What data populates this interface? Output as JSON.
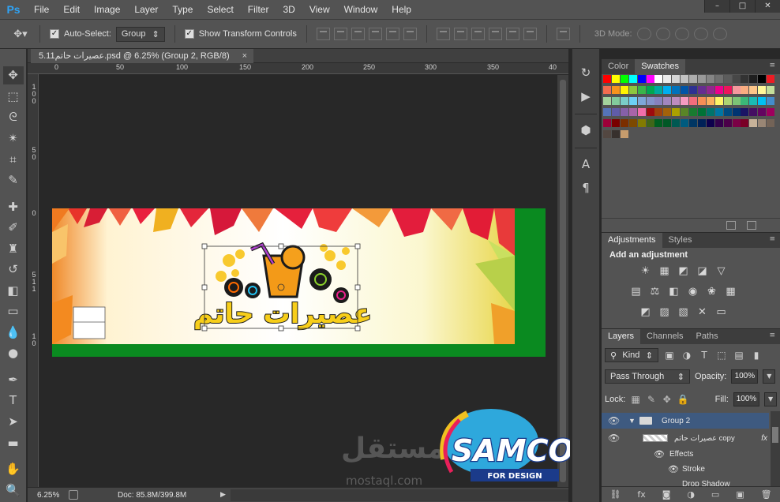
{
  "app": {
    "logo_text": "Ps",
    "menu": [
      "File",
      "Edit",
      "Image",
      "Layer",
      "Type",
      "Select",
      "Filter",
      "3D",
      "View",
      "Window",
      "Help"
    ],
    "window_controls": [
      "–",
      "□",
      "✕"
    ]
  },
  "options_bar": {
    "auto_select_label": "Auto-Select:",
    "auto_select_checked": true,
    "auto_select_target": "Group",
    "show_transform_label": "Show Transform Controls",
    "show_transform_checked": true,
    "mode3d_label": "3D Mode:"
  },
  "document": {
    "tab_title": "5.11عصيرات حاتم.psd @ 6.25% (Group 2, RGB/8)",
    "tab_close": "×",
    "ruler_top_labels": [
      "0",
      "50",
      "100",
      "150",
      "200",
      "250",
      "300",
      "350",
      "40"
    ],
    "ruler_left_labels": [
      "1 0 0",
      "5 0",
      "0",
      "5 1 1",
      "1 0"
    ],
    "artwork_title_ar": "عصيرات حاتم"
  },
  "status_bar": {
    "zoom": "6.25%",
    "doc_info": "Doc: 85.8M/399.8M"
  },
  "swatches_panel": {
    "tabs": [
      "Color",
      "Swatches"
    ],
    "active_tab": "Swatches",
    "colors": [
      [
        "#ff0000",
        "#ffff00",
        "#00ff00",
        "#00ffff",
        "#0000ff",
        "#ff00ff",
        "#ffffff",
        "#ebebeb",
        "#d6d6d6",
        "#c2c2c2",
        "#adadad",
        "#999999",
        "#858585",
        "#707070",
        "#5c5c5c",
        "#474747",
        "#333333",
        "#1f1f1f",
        "#000000",
        "#ed1c24"
      ],
      [
        "#f26c4f",
        "#f7941d",
        "#fff200",
        "#8dc73f",
        "#39b54a",
        "#00a651",
        "#00a99d",
        "#00aeef",
        "#0072bc",
        "#0054a6",
        "#2e3192",
        "#662d91",
        "#92278f",
        "#ec008c",
        "#ed145b",
        "#f5989d",
        "#f9ad81",
        "#fdc689",
        "#fff799",
        "#c4df9b"
      ],
      [
        "#a3d39c",
        "#82ca9c",
        "#7accc8",
        "#6dcff6",
        "#7da7d9",
        "#8393ca",
        "#8781bd",
        "#a186be",
        "#bd8cbf",
        "#f49ac1",
        "#f26d7d",
        "#f68e56",
        "#fbaf5d",
        "#fff467",
        "#acd372",
        "#7cc576",
        "#3bb878",
        "#1abbb4",
        "#00bff3",
        "#438ccb"
      ],
      [
        "#5574b9",
        "#605ca8",
        "#8560a8",
        "#a864a8",
        "#f06eaa",
        "#9e0b0f",
        "#a0410d",
        "#a36209",
        "#aba000",
        "#598527",
        "#197b30",
        "#007236",
        "#00746b",
        "#0076a3",
        "#004b80",
        "#003471",
        "#1b1464",
        "#440e62",
        "#630460",
        "#9e005d"
      ],
      [
        "#9e0039",
        "#790000",
        "#7b2e00",
        "#7d4900",
        "#827b00",
        "#406618",
        "#005e20",
        "#005826",
        "#005952",
        "#005b7f",
        "#003663",
        "#002157",
        "#0d004c",
        "#32004b",
        "#4b0049",
        "#7b0046",
        "#7a0026",
        "#c7b299",
        "#998675",
        "#736357"
      ],
      [
        "#534741",
        "#37302d",
        "#c69c6d"
      ]
    ]
  },
  "adjustments_panel": {
    "tabs": [
      "Adjustments",
      "Styles"
    ],
    "active_tab": "Adjustments",
    "heading": "Add an adjustment"
  },
  "layers_panel": {
    "tabs": [
      "Layers",
      "Channels",
      "Paths"
    ],
    "active_tab": "Layers",
    "filter_kind": "Kind",
    "blend_mode": "Pass Through",
    "opacity_label": "Opacity:",
    "opacity_value": "100%",
    "lock_label": "Lock:",
    "fill_label": "Fill:",
    "fill_value": "100%",
    "rows": [
      {
        "name": "Group 2",
        "type": "group",
        "selected": true
      },
      {
        "name": "عصيرات حاتم copy",
        "type": "layer",
        "fx": "fx"
      },
      {
        "name": "Effects",
        "type": "effects"
      },
      {
        "name": "Stroke",
        "type": "effect"
      },
      {
        "name": "Drop Shadow",
        "type": "effect"
      }
    ]
  },
  "watermark": {
    "samco": "SAMCO",
    "samco_sub": "FOR DESIGN",
    "mostaql_ar": "مستقل",
    "mostaql_url": "mostaql.com"
  }
}
